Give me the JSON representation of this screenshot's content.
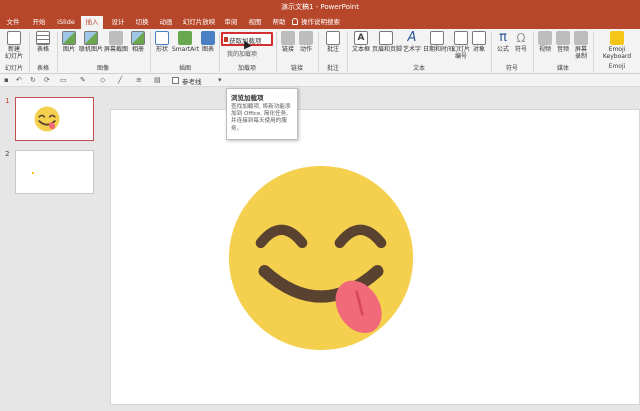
{
  "window": {
    "title": "演示文稿1 - PowerPoint"
  },
  "tabs": [
    {
      "label": "文件",
      "active": false
    },
    {
      "label": "开始",
      "active": false
    },
    {
      "label": "iSlide",
      "active": false
    },
    {
      "label": "插入",
      "active": true
    },
    {
      "label": "设计",
      "active": false
    },
    {
      "label": "切换",
      "active": false
    },
    {
      "label": "动画",
      "active": false
    },
    {
      "label": "幻灯片放映",
      "active": false
    },
    {
      "label": "审阅",
      "active": false
    },
    {
      "label": "视图",
      "active": false
    },
    {
      "label": "帮助",
      "active": false
    }
  ],
  "tell_me": "操作说明搜索",
  "ribbon": {
    "buttons": {
      "new_slide": "新建\n幻灯片",
      "table": "表格",
      "pictures": "图片",
      "online_pictures": "联机图片",
      "screenshot": "屏幕截图",
      "album": "相册",
      "shapes": "形状",
      "smartart": "SmartArt",
      "chart": "图表",
      "get_addins": "获取加载项",
      "my_addins": "我的加载项",
      "link": "链接",
      "action": "动作",
      "comment": "批注",
      "textbox": "文本框",
      "header_footer": "页眉和页脚",
      "wordart": "艺术字",
      "datetime": "日期和时间",
      "slide_number": "幻灯片\n编号",
      "object": "对象",
      "equation": "公式",
      "symbol": "符号",
      "video": "视频",
      "audio": "音频",
      "screen_recording": "屏幕\n录制",
      "emoji_keyboard": "Emoji\nKeyboard"
    },
    "groups": {
      "slides": "幻灯片",
      "tables": "表格",
      "images": "图像",
      "illustrations": "插图",
      "addins": "加载项",
      "links": "链接",
      "comments": "批注",
      "text": "文本",
      "symbols": "符号",
      "media": "媒体",
      "emoji": "Emoji"
    }
  },
  "qat": {
    "gridlines_label": "参考线"
  },
  "tooltip": {
    "title": "浏览加载项",
    "body": "查找加载项, 将新功能添加到 Office, 简化任务, 并连接到每天使用的服务。"
  },
  "slides": [
    {
      "number": "1",
      "selected": true
    },
    {
      "number": "2",
      "selected": false
    }
  ],
  "colors": {
    "accent": "#b7472a",
    "emoji_face": "#f5d04e",
    "emoji_features": "#5a4231",
    "tongue": "#f06a7a",
    "highlight_box": "#d32f2f"
  }
}
